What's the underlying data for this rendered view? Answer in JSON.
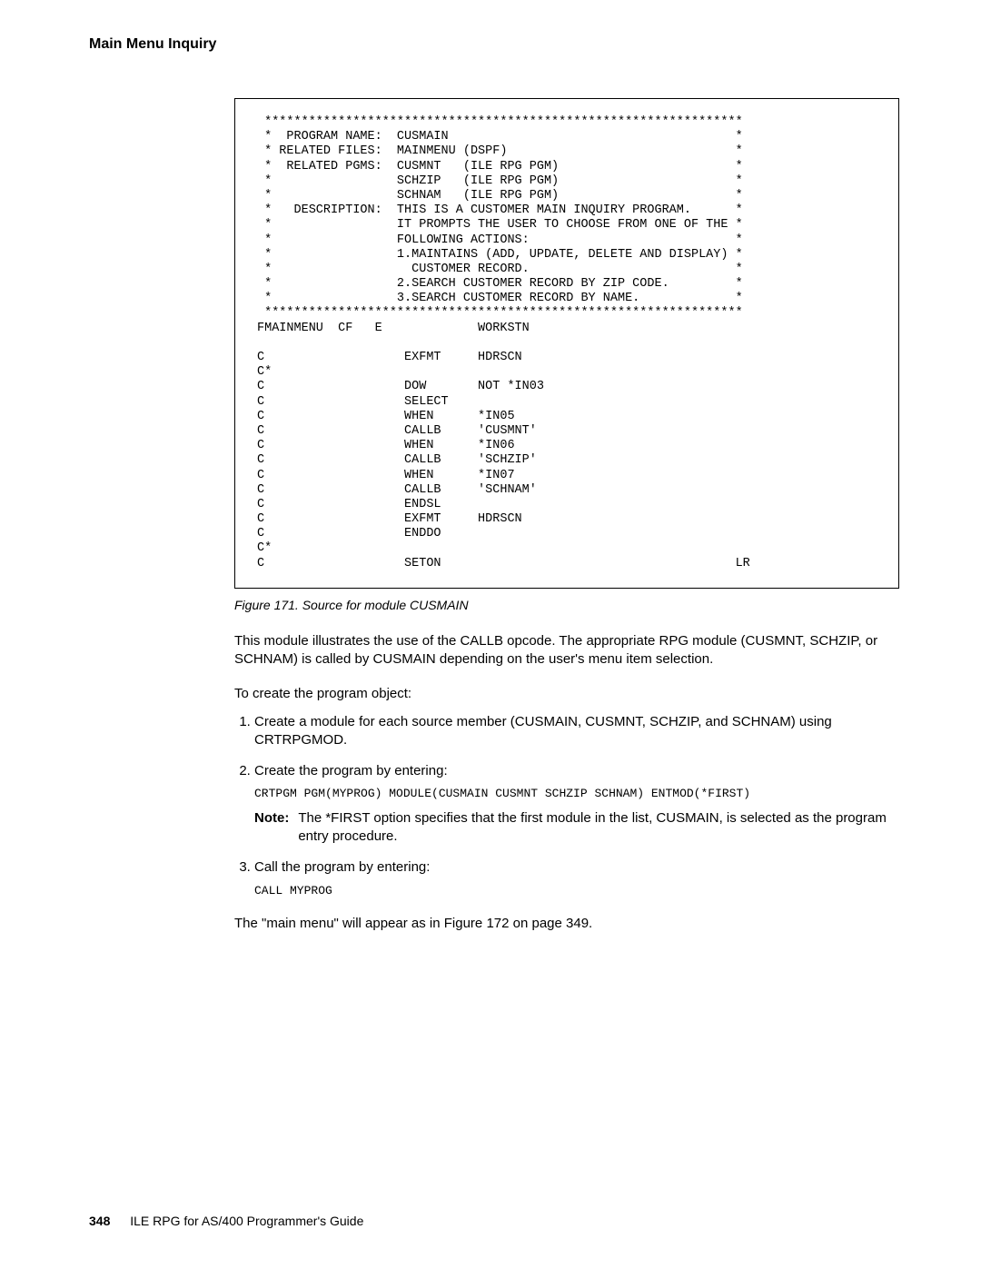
{
  "header": {
    "title": "Main Menu Inquiry"
  },
  "code_listing": " *****************************************************************\n *  PROGRAM NAME:  CUSMAIN                                       *\n * RELATED FILES:  MAINMENU (DSPF)                               *\n *  RELATED PGMS:  CUSMNT   (ILE RPG PGM)                        *\n *                 SCHZIP   (ILE RPG PGM)                        *\n *                 SCHNAM   (ILE RPG PGM)                        *\n *   DESCRIPTION:  THIS IS A CUSTOMER MAIN INQUIRY PROGRAM.      *\n *                 IT PROMPTS THE USER TO CHOOSE FROM ONE OF THE *\n *                 FOLLOWING ACTIONS:                            *\n *                 1.MAINTAINS (ADD, UPDATE, DELETE AND DISPLAY) *\n *                   CUSTOMER RECORD.                            *\n *                 2.SEARCH CUSTOMER RECORD BY ZIP CODE.         *\n *                 3.SEARCH CUSTOMER RECORD BY NAME.             *\n *****************************************************************\nFMAINMENU  CF   E             WORKSTN\n\nC                   EXFMT     HDRSCN\nC*\nC                   DOW       NOT *IN03\nC                   SELECT\nC                   WHEN      *IN05\nC                   CALLB     'CUSMNT'\nC                   WHEN      *IN06\nC                   CALLB     'SCHZIP'\nC                   WHEN      *IN07\nC                   CALLB     'SCHNAM'\nC                   ENDSL\nC                   EXFMT     HDRSCN\nC                   ENDDO\nC*\nC                   SETON                                        LR",
  "figure_caption": "Figure 171. Source for module CUSMAIN",
  "para1": "This module illustrates the use of the CALLB opcode. The appropriate RPG module (CUSMNT, SCHZIP, or SCHNAM) is called by CUSMAIN depending on the user's menu item selection.",
  "para2": "To create the program object:",
  "steps": {
    "s1": "Create a module for each source member (CUSMAIN, CUSMNT, SCHZIP, and SCHNAM) using CRTRPGMOD.",
    "s2": "Create the program by entering:",
    "s2_cmd": "CRTPGM PGM(MYPROG) MODULE(CUSMAIN CUSMNT SCHZIP SCHNAM) ENTMOD(*FIRST)",
    "s2_note_label": "Note:",
    "s2_note_text": "The *FIRST option specifies that the first module in the list, CUSMAIN, is selected as the program entry procedure.",
    "s3": "Call the program by entering:",
    "s3_cmd": "CALL MYPROG"
  },
  "para3": "The \"main menu\" will appear as in Figure 172 on page 349.",
  "footer": {
    "pagenum": "348",
    "booktitle": "ILE RPG for AS/400 Programmer's Guide"
  }
}
